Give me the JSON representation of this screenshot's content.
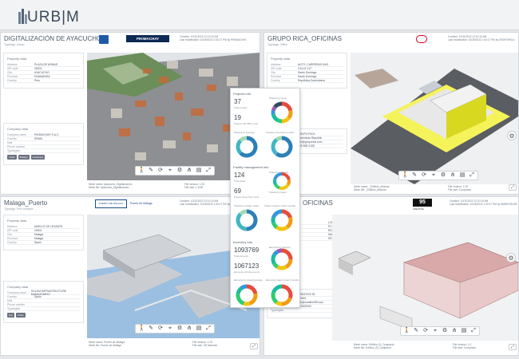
{
  "app": {
    "logo_text": "URB|M"
  },
  "panels": {
    "ayacucho": {
      "title": "DIGITALIZACIÓN DE AYACUCHO",
      "typology": "Typology: Urban",
      "creation": "Creation: 10/11/2022 12:10:10 AM",
      "last_mod": "Last modification: 10/26/2022 1:40:17 PM by PIKIMACHAY",
      "brand": "PIKIMACHAY",
      "property_title": "Property data",
      "property_rows": [
        [
          "Address",
          "PLAZA DE ARMAS"
        ],
        [
          "ZIP code",
          "05001"
        ],
        [
          "City",
          "AYACUCHO"
        ],
        [
          "Province",
          "HUAMANGA"
        ],
        [
          "Country",
          "Peru"
        ]
      ],
      "company_title": "Company data",
      "company_rows": [
        [
          "Company name",
          "PIKIMACHAY S.A.C."
        ],
        [
          "Country",
          "SPAIN"
        ],
        [
          "Mail",
          ""
        ],
        [
          "Phone number",
          ""
        ],
        [
          "Typologies",
          ""
        ]
      ],
      "tags": [
        "Urban",
        "Building",
        "Landscape"
      ],
      "foot_left": [
        "Mesh name: Ayacucho_Digitalización",
        "Mesh file: Ayacucho_Digitalización"
      ],
      "foot_right": [
        "File version: 1.00",
        "File size: 1.2GB"
      ]
    },
    "rica": {
      "title": "GRUPO RICA_OFICINAS",
      "typology": "Typology: Office",
      "creation": "Creation: 10/11/2022 12:10:10 AM",
      "last_mod": "Last modification: 10/26/2022 1:40:17 PM by GRUPORICA",
      "property_title": "Property data",
      "property_rows": [
        [
          "Address",
          "AUTO. CARRERAS KM3"
        ],
        [
          "ZIP code",
          "CALLE 147"
        ],
        [
          "City",
          "Santo Domingo"
        ],
        [
          "Province",
          "Santo Domingo"
        ],
        [
          "Country",
          "República Dominicana"
        ]
      ],
      "company_rows": [
        [
          "Company name",
          "GRUPO RICA"
        ],
        [
          "Country",
          "Dominican Republic"
        ],
        [
          "Mail",
          "info@gruporica.com"
        ],
        [
          "Phone number",
          "809 555 0155"
        ]
      ],
      "foot_left": [
        "Mesh name: _Edificio_oficinas",
        "Mesh file: _Edificio_oficinas"
      ],
      "foot_right": [
        "File version: 1.00",
        "File size: Compress"
      ]
    },
    "malaga": {
      "title": "Malaga_Puerto",
      "typology": "Typology: Port complex",
      "creation": "Creation: 10/11/2022 12:10:10 AM",
      "last_mod": "Last modification: 10/26/2022 1:40:17 PM by AUTORIDAD",
      "brand1": "PUERTO DE MÁLAGA",
      "brand2": "Puerto de Málaga",
      "property_title": "Property data",
      "property_rows": [
        [
          "Address",
          "MUELLE DE LEVANTE"
        ],
        [
          "ZIP code",
          "29001"
        ],
        [
          "City",
          "Málaga"
        ],
        [
          "Province",
          "Málaga"
        ],
        [
          "Country",
          "Spain"
        ]
      ],
      "company_title": "Company data",
      "company_rows": [
        [
          "Company name",
          "SOLIDA INFRASTRUCTURE MANAGEMENT"
        ],
        [
          "Country",
          "Spain"
        ],
        [
          "Mail",
          ""
        ],
        [
          "Phone number",
          ""
        ],
        [
          "Typologies",
          ""
        ]
      ],
      "tags": [
        "Port",
        "Urban"
      ],
      "foot_left": [
        "Mesh name: Puerto de Malaga",
        "Mesh file: Puerto de Malaga"
      ],
      "foot_right": [
        "File version: 1.00",
        "File size: 3D Network"
      ]
    },
    "oficinas": {
      "title": "OFICINAS",
      "creation": "Creation: 10/11/2022 12:10:10 AM",
      "last_mod": "Last modification: 10/26/2022 1:40:17 PM by WAREHOUSE",
      "brand": "95",
      "brand_sub": "CREATIVE",
      "property_rows": [
        [
          "",
          "LOMEDA 95"
        ],
        [
          "",
          "PCA 13"
        ],
        [
          "",
          "RDWN"
        ],
        [
          "",
          "MADRID"
        ],
        [
          "",
          "SPAIN"
        ]
      ],
      "company_rows": [
        [
          "Company name",
          "CREATIVE 95"
        ],
        [
          "Country",
          "SPAIN"
        ],
        [
          "Mail",
          "info@creative95.com"
        ],
        [
          "Phone number",
          "910000000"
        ],
        [
          "Typologies",
          ""
        ]
      ],
      "foot_left": [
        "Mesh name: Edificio_B_Compacto",
        "Mesh file: Edificio_B_Compacto"
      ],
      "foot_right": [
        "File version: 1.0",
        "File size: Compress"
      ]
    }
  },
  "stats": {
    "projects_title": "Projects info",
    "projects_count": "37",
    "projects_count_label": "Total projects",
    "projects_b": "19",
    "projects_b_label": "Projects with BIM model",
    "charts1": [
      "Projects by owner",
      "Projects by Typology",
      "Created in the last 6 months"
    ],
    "facility_title": "Facility management info",
    "facility_count": "124",
    "facility_count_label": "Total tickets",
    "facility_b": "69",
    "facility_b_label": "Tickets closed this month",
    "charts2": [
      "Tickets by category",
      "Tickets by project",
      "Tickets by creation status",
      "Tickets: project in last 6 months"
    ],
    "inventory_title": "Inventory info",
    "inventory_count": "1093769",
    "inventory_count_label": "Total elements",
    "inventory_b": "1067123",
    "inventory_b_label": "Elements with documents",
    "charts3": [
      "Elements by category",
      "Elements by project typology",
      "Elements project in last 6 months"
    ]
  },
  "toolbar_icons": [
    "person-icon",
    "pencil-icon",
    "orbit-icon",
    "measure-icon",
    "gear-icon",
    "hierarchy-icon",
    "layers-icon",
    "fullscreen-icon"
  ]
}
